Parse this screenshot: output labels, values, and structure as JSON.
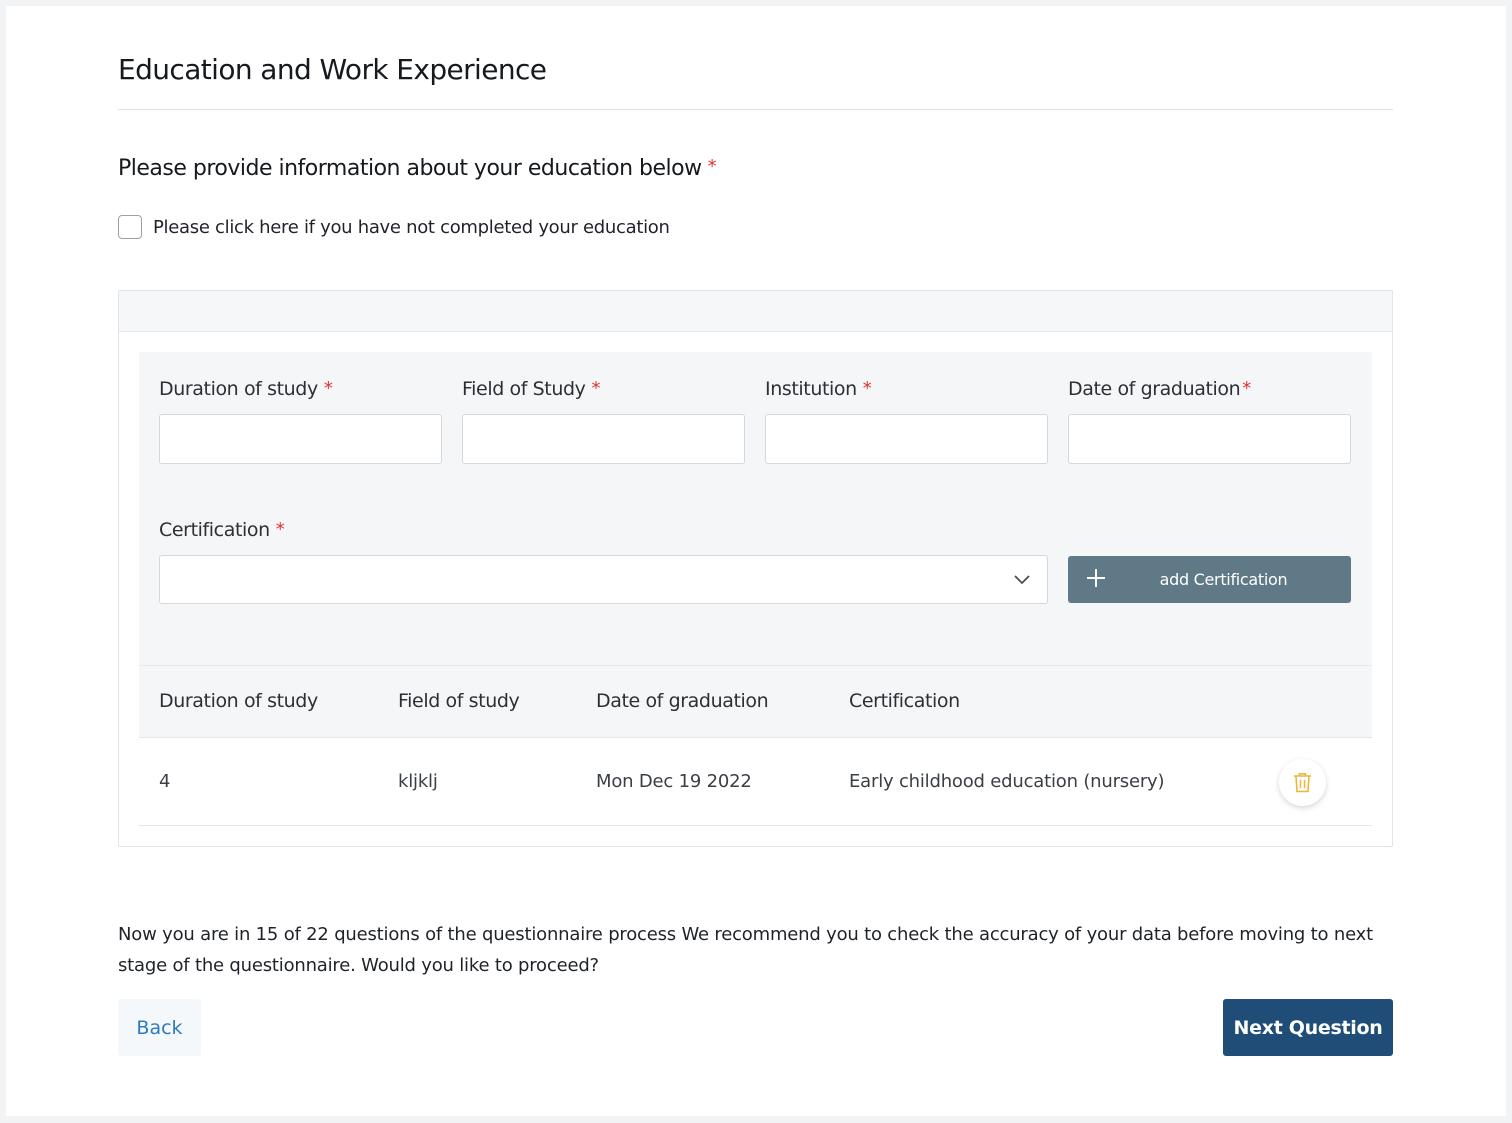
{
  "page": {
    "title": "Education and Work Experience"
  },
  "question": {
    "text": "Please provide information about your education below",
    "required_mark": "*",
    "checkbox_label": "Please click here if you have not completed your education",
    "checkbox_checked": false
  },
  "form": {
    "fields": [
      {
        "label": "Duration of study",
        "required": "*",
        "value": ""
      },
      {
        "label": "Field of Study",
        "required": "*",
        "value": ""
      },
      {
        "label": "Institution",
        "required": "*",
        "value": ""
      },
      {
        "label": "Date of graduation",
        "required": "*",
        "value": ""
      }
    ],
    "certification": {
      "label": "Certification",
      "required": "*",
      "selected": ""
    },
    "add_button_label": "add Certification"
  },
  "table": {
    "headers": [
      "Duration of study",
      "Field of study",
      "Date of graduation",
      "Certification"
    ],
    "rows": [
      {
        "duration": "4",
        "field": "kljklj",
        "date": "Mon Dec 19 2022",
        "certification": "Early childhood education (nursery)"
      }
    ]
  },
  "footer": {
    "note": "Now you are in 15 of 22 questions of the questionnaire process We recommend you to check the accuracy of your data before moving to next stage of the questionnaire. Would you like to proceed?",
    "back_label": "Back",
    "next_label": "Next Question"
  },
  "colors": {
    "primary": "#1f4d78",
    "secondary_button": "#5f7a86",
    "required": "#e03131",
    "link": "#2f7bbf",
    "trash_icon": "#f0b43c"
  }
}
